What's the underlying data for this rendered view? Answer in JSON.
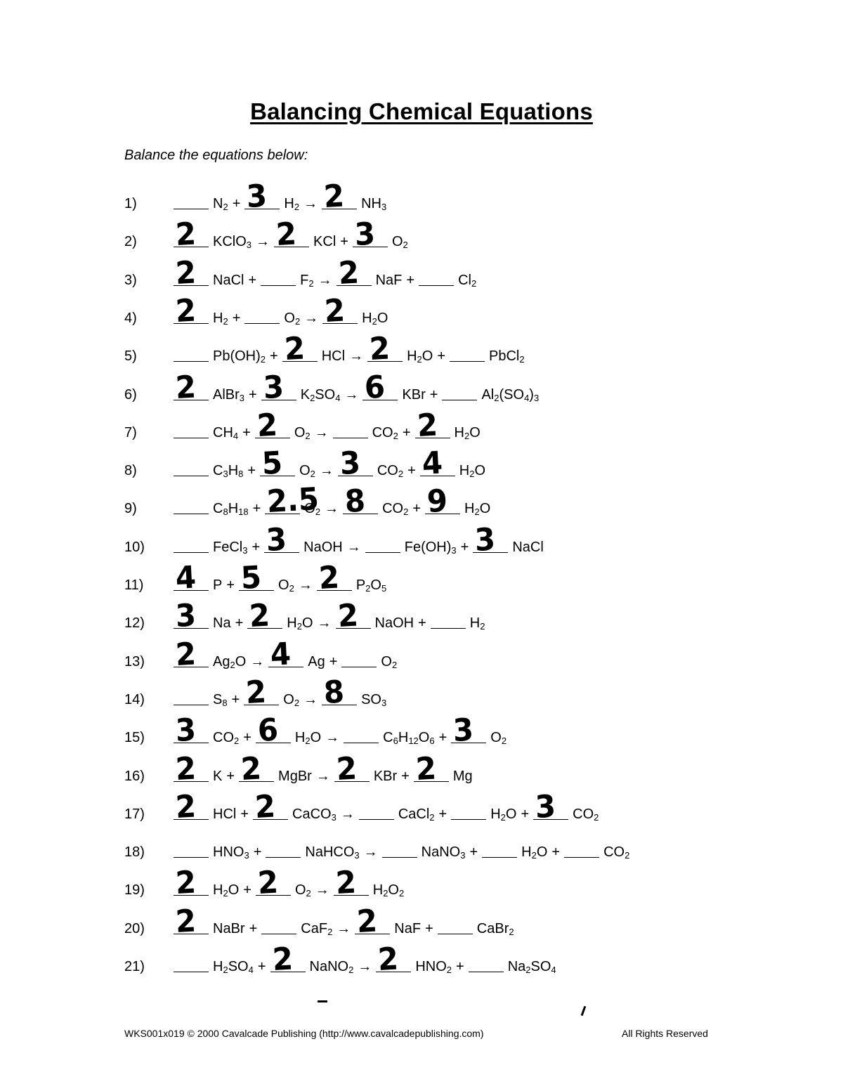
{
  "title": "Balancing Chemical Equations",
  "instructions": "Balance the equations below:",
  "equations": [
    {
      "num": "1)",
      "reactants": [
        {
          "coef": "",
          "formula": [
            [
              "N",
              ""
            ],
            [
              "",
              "2"
            ]
          ]
        },
        {
          "coef": "3",
          "formula": [
            [
              "H",
              ""
            ],
            [
              "",
              "2"
            ]
          ]
        }
      ],
      "products": [
        {
          "coef": "2",
          "formula": [
            [
              "NH",
              ""
            ],
            [
              "",
              "3"
            ]
          ]
        }
      ]
    },
    {
      "num": "2)",
      "reactants": [
        {
          "coef": "2",
          "formula": [
            [
              "KClO",
              ""
            ],
            [
              "",
              "3"
            ]
          ]
        }
      ],
      "products": [
        {
          "coef": "2",
          "formula": [
            [
              "KCl",
              ""
            ]
          ]
        },
        {
          "coef": "3",
          "formula": [
            [
              "O",
              ""
            ],
            [
              "",
              "2"
            ]
          ]
        }
      ]
    },
    {
      "num": "3)",
      "reactants": [
        {
          "coef": "2",
          "formula": [
            [
              "NaCl",
              ""
            ]
          ]
        },
        {
          "coef": "",
          "formula": [
            [
              "F",
              ""
            ],
            [
              "",
              "2"
            ]
          ]
        }
      ],
      "products": [
        {
          "coef": "2",
          "formula": [
            [
              "NaF",
              ""
            ]
          ]
        },
        {
          "coef": "",
          "formula": [
            [
              "Cl",
              ""
            ],
            [
              "",
              "2"
            ]
          ]
        }
      ]
    },
    {
      "num": "4)",
      "reactants": [
        {
          "coef": "2",
          "formula": [
            [
              "H",
              ""
            ],
            [
              "",
              "2"
            ]
          ]
        },
        {
          "coef": "",
          "formula": [
            [
              "O",
              ""
            ],
            [
              "",
              "2"
            ]
          ]
        }
      ],
      "products": [
        {
          "coef": "2",
          "formula": [
            [
              "H",
              ""
            ],
            [
              "",
              "2"
            ],
            [
              "O",
              ""
            ]
          ]
        }
      ]
    },
    {
      "num": "5)",
      "reactants": [
        {
          "coef": "",
          "formula": [
            [
              "Pb(OH)",
              ""
            ],
            [
              "",
              "2"
            ]
          ]
        },
        {
          "coef": "2",
          "formula": [
            [
              "HCl",
              ""
            ]
          ]
        }
      ],
      "products": [
        {
          "coef": "2",
          "formula": [
            [
              "H",
              ""
            ],
            [
              "",
              "2"
            ],
            [
              "O",
              ""
            ]
          ]
        },
        {
          "coef": "",
          "formula": [
            [
              "PbCl",
              ""
            ],
            [
              "",
              "2"
            ]
          ]
        }
      ]
    },
    {
      "num": "6)",
      "reactants": [
        {
          "coef": "2",
          "formula": [
            [
              "AlBr",
              ""
            ],
            [
              "",
              "3"
            ]
          ]
        },
        {
          "coef": "3",
          "formula": [
            [
              "K",
              ""
            ],
            [
              "",
              "2"
            ],
            [
              "SO",
              ""
            ],
            [
              "",
              "4"
            ]
          ]
        }
      ],
      "products": [
        {
          "coef": "6",
          "formula": [
            [
              "KBr",
              ""
            ]
          ]
        },
        {
          "coef": "",
          "formula": [
            [
              "Al",
              ""
            ],
            [
              "",
              "2"
            ],
            [
              "(SO",
              ""
            ],
            [
              "",
              "4"
            ],
            [
              ")",
              ""
            ],
            [
              "",
              "3"
            ]
          ]
        }
      ]
    },
    {
      "num": "7)",
      "reactants": [
        {
          "coef": "",
          "formula": [
            [
              "CH",
              ""
            ],
            [
              "",
              "4"
            ]
          ]
        },
        {
          "coef": "2",
          "formula": [
            [
              "O",
              ""
            ],
            [
              "",
              "2"
            ]
          ]
        }
      ],
      "products": [
        {
          "coef": "",
          "formula": [
            [
              "CO",
              ""
            ],
            [
              "",
              "2"
            ]
          ]
        },
        {
          "coef": "2",
          "formula": [
            [
              "H",
              ""
            ],
            [
              "",
              "2"
            ],
            [
              "O",
              ""
            ]
          ]
        }
      ]
    },
    {
      "num": "8)",
      "reactants": [
        {
          "coef": "",
          "formula": [
            [
              "C",
              ""
            ],
            [
              "",
              "3"
            ],
            [
              "H",
              ""
            ],
            [
              "",
              "8"
            ]
          ]
        },
        {
          "coef": "5",
          "formula": [
            [
              "O",
              ""
            ],
            [
              "",
              "2"
            ]
          ]
        }
      ],
      "products": [
        {
          "coef": "3",
          "formula": [
            [
              "CO",
              ""
            ],
            [
              "",
              "2"
            ]
          ]
        },
        {
          "coef": "4",
          "formula": [
            [
              "H",
              ""
            ],
            [
              "",
              "2"
            ],
            [
              "O",
              ""
            ]
          ]
        }
      ]
    },
    {
      "num": "9)",
      "reactants": [
        {
          "coef": "",
          "formula": [
            [
              "C",
              ""
            ],
            [
              "",
              "8"
            ],
            [
              "H",
              ""
            ],
            [
              "",
              "18"
            ]
          ]
        },
        {
          "coef": "2.5",
          "formula": [
            [
              "O",
              ""
            ],
            [
              "",
              "2"
            ]
          ]
        }
      ],
      "products": [
        {
          "coef": "8",
          "formula": [
            [
              "CO",
              ""
            ],
            [
              "",
              "2"
            ]
          ]
        },
        {
          "coef": "9",
          "formula": [
            [
              "H",
              ""
            ],
            [
              "",
              "2"
            ],
            [
              "O",
              ""
            ]
          ]
        }
      ]
    },
    {
      "num": "10)",
      "reactants": [
        {
          "coef": "",
          "formula": [
            [
              "FeCl",
              ""
            ],
            [
              "",
              "3"
            ]
          ]
        },
        {
          "coef": "3",
          "formula": [
            [
              "NaOH",
              ""
            ]
          ]
        }
      ],
      "products": [
        {
          "coef": "",
          "formula": [
            [
              "Fe(OH)",
              ""
            ],
            [
              "",
              "3"
            ]
          ]
        },
        {
          "coef": "3",
          "formula": [
            [
              "NaCl",
              ""
            ]
          ]
        }
      ]
    },
    {
      "num": "11)",
      "reactants": [
        {
          "coef": "4",
          "formula": [
            [
              "P",
              ""
            ]
          ]
        },
        {
          "coef": "5",
          "formula": [
            [
              "O",
              ""
            ],
            [
              "",
              "2"
            ]
          ]
        }
      ],
      "products": [
        {
          "coef": "2",
          "formula": [
            [
              "P",
              ""
            ],
            [
              "",
              "2"
            ],
            [
              "O",
              ""
            ],
            [
              "",
              "5"
            ]
          ]
        }
      ]
    },
    {
      "num": "12)",
      "reactants": [
        {
          "coef": "3",
          "formula": [
            [
              "Na",
              ""
            ]
          ]
        },
        {
          "coef": "2",
          "formula": [
            [
              "H",
              ""
            ],
            [
              "",
              "2"
            ],
            [
              "O",
              ""
            ]
          ]
        }
      ],
      "products": [
        {
          "coef": "2",
          "formula": [
            [
              "NaOH",
              ""
            ]
          ]
        },
        {
          "coef": "",
          "formula": [
            [
              "H",
              ""
            ],
            [
              "",
              "2"
            ]
          ]
        }
      ]
    },
    {
      "num": "13)",
      "reactants": [
        {
          "coef": "2",
          "formula": [
            [
              "Ag",
              ""
            ],
            [
              "",
              "2"
            ],
            [
              "O",
              ""
            ]
          ]
        }
      ],
      "products": [
        {
          "coef": "4",
          "formula": [
            [
              "Ag",
              ""
            ]
          ]
        },
        {
          "coef": "",
          "formula": [
            [
              "O",
              ""
            ],
            [
              "",
              "2"
            ]
          ]
        }
      ]
    },
    {
      "num": "14)",
      "reactants": [
        {
          "coef": "",
          "formula": [
            [
              "S",
              ""
            ],
            [
              "",
              "8"
            ]
          ]
        },
        {
          "coef": "2",
          "formula": [
            [
              "O",
              ""
            ],
            [
              "",
              "2"
            ]
          ]
        }
      ],
      "products": [
        {
          "coef": "8",
          "formula": [
            [
              "SO",
              ""
            ],
            [
              "",
              "3"
            ]
          ]
        }
      ]
    },
    {
      "num": "15)",
      "reactants": [
        {
          "coef": "3",
          "formula": [
            [
              "CO",
              ""
            ],
            [
              "",
              "2"
            ]
          ]
        },
        {
          "coef": "6",
          "formula": [
            [
              "H",
              ""
            ],
            [
              "",
              "2"
            ],
            [
              "O",
              ""
            ]
          ]
        }
      ],
      "products": [
        {
          "coef": "",
          "formula": [
            [
              "C",
              ""
            ],
            [
              "",
              "6"
            ],
            [
              "H",
              ""
            ],
            [
              "",
              "12"
            ],
            [
              "O",
              ""
            ],
            [
              "",
              "6"
            ]
          ]
        },
        {
          "coef": "3",
          "formula": [
            [
              "O",
              ""
            ],
            [
              "",
              "2"
            ]
          ]
        }
      ]
    },
    {
      "num": "16)",
      "reactants": [
        {
          "coef": "2",
          "formula": [
            [
              "K",
              ""
            ]
          ]
        },
        {
          "coef": "2",
          "formula": [
            [
              "MgBr",
              ""
            ]
          ]
        }
      ],
      "products": [
        {
          "coef": "2",
          "formula": [
            [
              "KBr",
              ""
            ]
          ]
        },
        {
          "coef": "2",
          "formula": [
            [
              "Mg",
              ""
            ]
          ]
        }
      ]
    },
    {
      "num": "17)",
      "reactants": [
        {
          "coef": "2",
          "formula": [
            [
              "HCl",
              ""
            ]
          ]
        },
        {
          "coef": "2",
          "formula": [
            [
              "CaCO",
              ""
            ],
            [
              "",
              "3"
            ]
          ]
        }
      ],
      "products": [
        {
          "coef": "",
          "formula": [
            [
              "CaCl",
              ""
            ],
            [
              "",
              "2"
            ]
          ]
        },
        {
          "coef": "",
          "formula": [
            [
              "H",
              ""
            ],
            [
              "",
              "2"
            ],
            [
              "O",
              ""
            ]
          ]
        },
        {
          "coef": "3",
          "formula": [
            [
              "CO",
              ""
            ],
            [
              "",
              "2"
            ]
          ]
        }
      ]
    },
    {
      "num": "18)",
      "reactants": [
        {
          "coef": "",
          "formula": [
            [
              "HNO",
              ""
            ],
            [
              "",
              "3"
            ]
          ]
        },
        {
          "coef": "",
          "formula": [
            [
              "NaHCO",
              ""
            ],
            [
              "",
              "3"
            ]
          ]
        }
      ],
      "products": [
        {
          "coef": "",
          "formula": [
            [
              "NaNO",
              ""
            ],
            [
              "",
              "3"
            ]
          ]
        },
        {
          "coef": "",
          "formula": [
            [
              "H",
              ""
            ],
            [
              "",
              "2"
            ],
            [
              "O",
              ""
            ]
          ]
        },
        {
          "coef": "",
          "formula": [
            [
              "CO",
              ""
            ],
            [
              "",
              "2"
            ]
          ]
        }
      ]
    },
    {
      "num": "19)",
      "reactants": [
        {
          "coef": "2",
          "formula": [
            [
              "H",
              ""
            ],
            [
              "",
              "2"
            ],
            [
              "O",
              ""
            ]
          ]
        },
        {
          "coef": "2",
          "formula": [
            [
              "O",
              ""
            ],
            [
              "",
              "2"
            ]
          ]
        }
      ],
      "products": [
        {
          "coef": "2",
          "formula": [
            [
              "H",
              ""
            ],
            [
              "",
              "2"
            ],
            [
              "O",
              ""
            ],
            [
              "",
              "2"
            ]
          ]
        }
      ]
    },
    {
      "num": "20)",
      "reactants": [
        {
          "coef": "2",
          "formula": [
            [
              "NaBr",
              ""
            ]
          ]
        },
        {
          "coef": "",
          "formula": [
            [
              "CaF",
              ""
            ],
            [
              "",
              "2"
            ]
          ]
        }
      ],
      "products": [
        {
          "coef": "2",
          "formula": [
            [
              "NaF",
              ""
            ]
          ]
        },
        {
          "coef": "",
          "formula": [
            [
              "CaBr",
              ""
            ],
            [
              "",
              "2"
            ]
          ]
        }
      ]
    },
    {
      "num": "21)",
      "reactants": [
        {
          "coef": "",
          "formula": [
            [
              "H",
              ""
            ],
            [
              "",
              "2"
            ],
            [
              "SO",
              ""
            ],
            [
              "",
              "4"
            ]
          ]
        },
        {
          "coef": "2",
          "formula": [
            [
              "NaNO",
              ""
            ],
            [
              "",
              "2"
            ]
          ]
        }
      ],
      "products": [
        {
          "coef": "2",
          "formula": [
            [
              "HNO",
              ""
            ],
            [
              "",
              "2"
            ]
          ]
        },
        {
          "coef": "",
          "formula": [
            [
              "Na",
              ""
            ],
            [
              "",
              "2"
            ],
            [
              "SO",
              ""
            ],
            [
              "",
              "4"
            ]
          ]
        }
      ]
    }
  ],
  "symbols": {
    "plus": "+",
    "arrow": "→"
  },
  "footer": {
    "left": "WKS001x019  © 2000 Cavalcade Publishing (http://www.cavalcadepublishing.com)",
    "right": "All Rights Reserved"
  }
}
